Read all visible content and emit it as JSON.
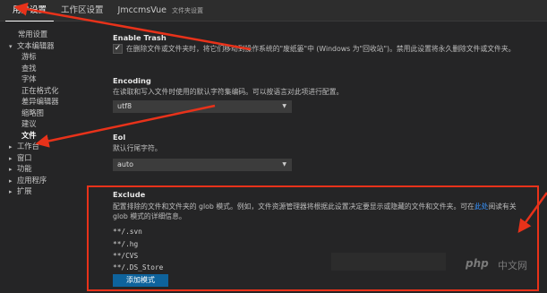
{
  "tabs": [
    {
      "label": "用户设置"
    },
    {
      "label": "工作区设置"
    },
    {
      "label": "JmccmsVue",
      "sub": "文件夹设置"
    }
  ],
  "sidebar": {
    "items": [
      {
        "label": "常用设置"
      },
      {
        "label": "文本编辑器"
      },
      {
        "label": "游标"
      },
      {
        "label": "查找"
      },
      {
        "label": "字体"
      },
      {
        "label": "正在格式化"
      },
      {
        "label": "差异编辑器"
      },
      {
        "label": "缩略图"
      },
      {
        "label": "建议"
      },
      {
        "label": "文件"
      },
      {
        "label": "工作台"
      },
      {
        "label": "窗口"
      },
      {
        "label": "功能"
      },
      {
        "label": "应用程序"
      },
      {
        "label": "扩展"
      }
    ]
  },
  "settings": {
    "trash": {
      "title": "Enable Trash",
      "desc": "在删除文件或文件夹时，将它们移动到操作系统的\"废纸篓\"中 (Windows 为\"回收站\")。禁用此设置将永久删除文件或文件夹。",
      "checkmark": "✓"
    },
    "encoding": {
      "title": "Encoding",
      "desc": "在读取和写入文件时使用的默认字符集编码。可以按语言对此项进行配置。",
      "value": "utf8"
    },
    "eol": {
      "title": "Eol",
      "desc": "默认行尾字符。",
      "value": "auto"
    },
    "exclude": {
      "title": "Exclude",
      "desc_line1_a": "配置排除的文件和文件夹的 glob 模式。例如，文件资源管理器将根据此设置决定要显示或隐藏的文件和文件夹。可在",
      "desc_link": "此处",
      "desc_line1_b": "阅读有关",
      "desc_line2": "glob 模式的详细信息。",
      "patterns": [
        "**/.svn",
        "**/.hg",
        "**/CVS",
        "**/.DS_Store"
      ],
      "add_button": "添加模式"
    }
  },
  "watermark": {
    "logo": "php",
    "text": "中文网"
  },
  "colors": {
    "accent": "#0e639c",
    "highlight": "#e8321a",
    "link": "#3794ff"
  }
}
